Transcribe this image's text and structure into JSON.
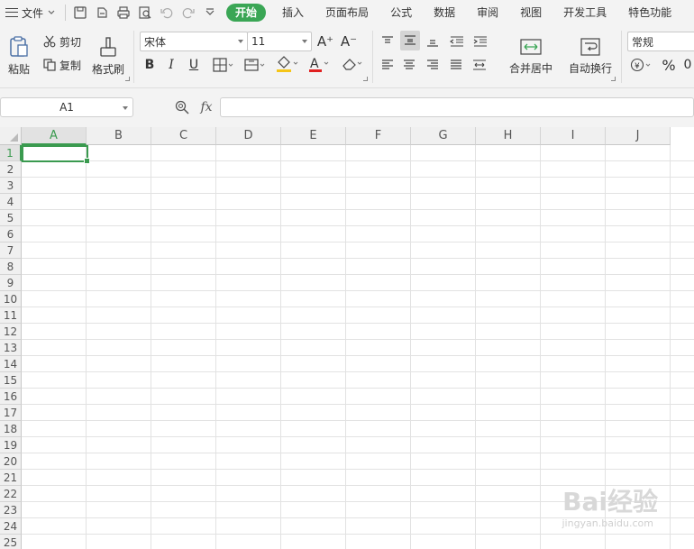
{
  "menubar": {
    "file_label": "文件",
    "tabs": [
      "开始",
      "插入",
      "页面布局",
      "公式",
      "数据",
      "审阅",
      "视图",
      "开发工具",
      "特色功能"
    ],
    "active_tab": "开始"
  },
  "ribbon": {
    "paste_label": "粘贴",
    "cut_label": "剪切",
    "copy_label": "复制",
    "format_painter_label": "格式刷",
    "font_name": "宋体",
    "font_size": "11",
    "merge_center_label": "合并居中",
    "wrap_text_label": "自动换行",
    "number_format": "常规",
    "percent_symbol": "%"
  },
  "formula_bar": {
    "name_box": "A1",
    "fx_label": "fx",
    "formula_value": ""
  },
  "sheet": {
    "columns": [
      "A",
      "B",
      "C",
      "D",
      "E",
      "F",
      "G",
      "H",
      "I",
      "J"
    ],
    "rows": [
      "1",
      "2",
      "3",
      "4",
      "5",
      "6",
      "7",
      "8",
      "9",
      "10",
      "11",
      "12",
      "13",
      "14",
      "15",
      "16",
      "17",
      "18",
      "19",
      "20",
      "21",
      "22",
      "23",
      "24",
      "25"
    ],
    "selected_cell": "A1"
  },
  "watermark": {
    "text": "Bai经验",
    "sub": "jingyan.baidu.com"
  },
  "colors": {
    "accent": "#3aa655",
    "selection": "#3a9a4f"
  }
}
